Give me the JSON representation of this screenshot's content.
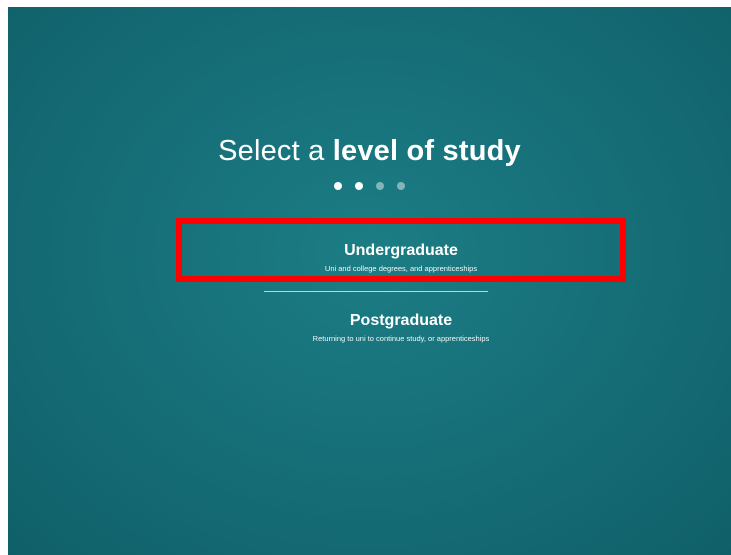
{
  "header": {
    "title_light": "Select a ",
    "title_bold": "level of study"
  },
  "progress": {
    "total_steps": 4,
    "active_steps": 2
  },
  "options": [
    {
      "title": "Undergraduate",
      "subtitle": "Uni and college degrees, and apprenticeships",
      "highlighted": true
    },
    {
      "title": "Postgraduate",
      "subtitle": "Returning to uni to continue study, or apprenticeships",
      "highlighted": false
    }
  ],
  "colors": {
    "background": "#17717a",
    "text": "#ffffff",
    "highlight_border": "#ff0000",
    "dot_inactive": "rgba(255,255,255,0.45)"
  }
}
